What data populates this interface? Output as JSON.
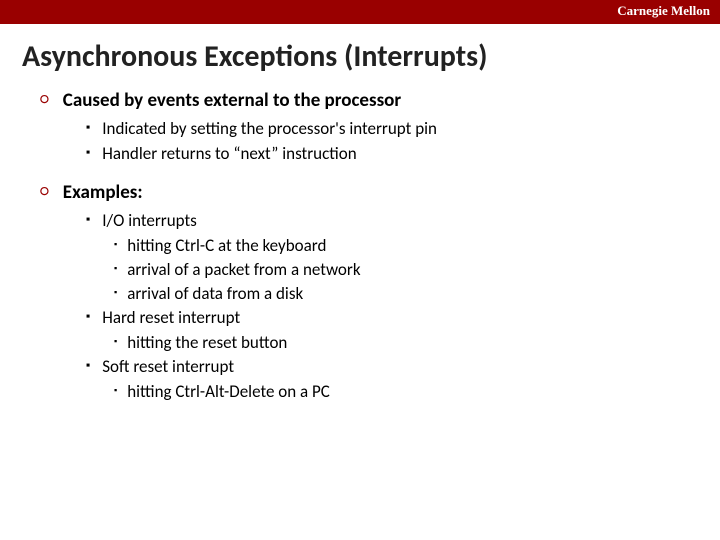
{
  "header": {
    "label": "Carnegie Mellon"
  },
  "title": "Asynchronous Exceptions (Interrupts)",
  "sections": [
    {
      "heading": "Caused by events external to the processor",
      "items": [
        {
          "text": "Indicated by setting the processor's interrupt pin"
        },
        {
          "text": "Handler returns to “next” instruction"
        }
      ]
    },
    {
      "heading": "Examples:",
      "items": [
        {
          "text": "I/O interrupts",
          "subitems": [
            "hitting Ctrl-C at the keyboard",
            "arrival of a packet from a network",
            "arrival of data from a disk"
          ]
        },
        {
          "text": "Hard reset interrupt",
          "subitems": [
            "hitting the reset button"
          ]
        },
        {
          "text": "Soft reset interrupt",
          "subitems": [
            "hitting Ctrl-Alt-Delete on a PC"
          ]
        }
      ]
    }
  ]
}
